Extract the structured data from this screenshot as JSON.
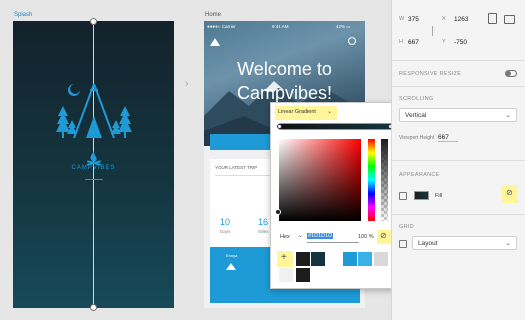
{
  "artboards": {
    "splash_label": "Splash",
    "home_label": "Home"
  },
  "splash": {
    "brand": "CAMPVIBES"
  },
  "home": {
    "status_carrier": "●●●●○ Carrier",
    "status_time": "9:41 AM",
    "status_battery": "42% ▭",
    "welcome": "Welcome to",
    "app_name": "Campvibes!",
    "latest_trip": "YOUR LATEST TRIP",
    "stat1_value": "10",
    "stat1_label": "Days",
    "stat2_value": "16",
    "stat2_label": "Miles",
    "card_label": "Ennya"
  },
  "picker": {
    "mode": "Linear Gradient",
    "format": "Hex",
    "hex_value": "#1D1D1D",
    "opacity": "100 %",
    "add_label": "+"
  },
  "panel": {
    "w_label": "W",
    "w_value": "375",
    "h_label": "H",
    "h_value": "667",
    "x_label": "X",
    "x_value": "1263",
    "y_label": "Y",
    "y_value": "-750",
    "responsive_resize": "RESPONSIVE RESIZE",
    "scrolling": "SCROLLING",
    "scroll_value": "Vertical",
    "viewport_label": "Viewport Height",
    "viewport_value": "667",
    "appearance": "APPEARANCE",
    "fill_label": "Fill",
    "grid": "GRID",
    "grid_value": "Layout"
  },
  "colors": {
    "accent": "#1e9ad6",
    "splash_bg": "#13222b",
    "highlight": "#fff59a"
  }
}
